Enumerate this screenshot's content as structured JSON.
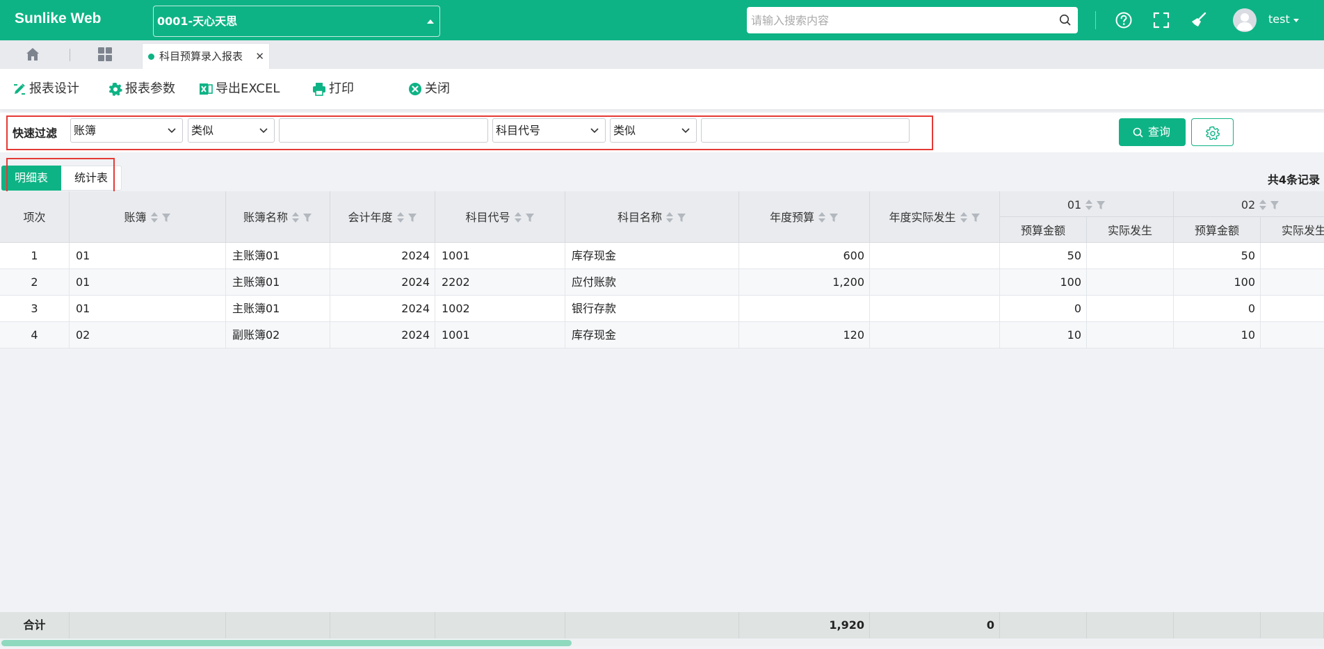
{
  "app": {
    "brand": "Sunlike Web",
    "account": "0001-天心天思",
    "search_placeholder": "请输入搜索内容",
    "user": "test",
    "icons": [
      "help-icon",
      "fullscreen-icon",
      "broom-icon",
      "user-avatar-icon"
    ]
  },
  "tabs": {
    "report_tab": "科目预算录入报表"
  },
  "toolbar": {
    "design": "报表设计",
    "params": "报表参数",
    "export": "导出EXCEL",
    "print": "打印",
    "close": "关闭"
  },
  "filter": {
    "label": "快速过滤",
    "field1": "账簿",
    "op1": "类似",
    "value1": "",
    "field2": "科目代号",
    "op2": "类似",
    "value2": "",
    "query": "查询"
  },
  "view": {
    "detail": "明细表",
    "summary": "统计表",
    "record_count": "共4条记录"
  },
  "table": {
    "headers": {
      "seq": "项次",
      "book": "账簿",
      "book_name": "账簿名称",
      "fiscal_year": "会计年度",
      "account_code": "科目代号",
      "account_name": "科目名称",
      "annual_budget": "年度预算",
      "annual_actual": "年度实际发生",
      "period1": "01",
      "period2": "02",
      "budget_amount": "预算金额",
      "actual": "实际发生"
    },
    "rows": [
      {
        "seq": "1",
        "book": "01",
        "book_name": "主账簿01",
        "year": "2024",
        "code": "1001",
        "name": "库存现金",
        "budget": "600",
        "actual": "",
        "p1_budget": "50",
        "p1_actual": "",
        "p2_budget": "50",
        "p2_actual": ""
      },
      {
        "seq": "2",
        "book": "01",
        "book_name": "主账簿01",
        "year": "2024",
        "code": "2202",
        "name": "应付账款",
        "budget": "1,200",
        "actual": "",
        "p1_budget": "100",
        "p1_actual": "",
        "p2_budget": "100",
        "p2_actual": ""
      },
      {
        "seq": "3",
        "book": "01",
        "book_name": "主账簿01",
        "year": "2024",
        "code": "1002",
        "name": "银行存款",
        "budget": "",
        "actual": "",
        "p1_budget": "0",
        "p1_actual": "",
        "p2_budget": "0",
        "p2_actual": ""
      },
      {
        "seq": "4",
        "book": "02",
        "book_name": "副账簿02",
        "year": "2024",
        "code": "1001",
        "name": "库存现金",
        "budget": "120",
        "actual": "",
        "p1_budget": "10",
        "p1_actual": "",
        "p2_budget": "10",
        "p2_actual": ""
      }
    ],
    "totals": {
      "label": "合计",
      "budget": "1,920",
      "actual": "0"
    }
  }
}
